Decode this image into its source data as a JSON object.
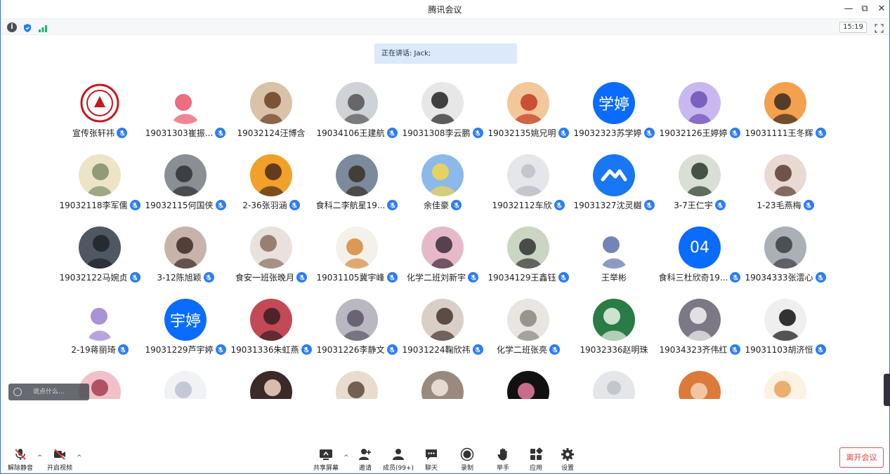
{
  "window": {
    "title": "腾讯会议",
    "minimize": "—",
    "restore": "⧉",
    "close": "✕"
  },
  "infobar": {
    "info_icon": "info-icon",
    "clock": "15:19"
  },
  "speaking": {
    "text": "正在讲话: Jack;"
  },
  "participants": [
    {
      "name": "宣传张轩祎",
      "avatar": "red-seal"
    },
    {
      "name": "19031303崔振...",
      "avatar": "cartoon-figure"
    },
    {
      "name": "19032124汪博含",
      "avatar": "brown-bear",
      "mic": false
    },
    {
      "name": "19034106王建航",
      "avatar": "photo-gray"
    },
    {
      "name": "19031308李云鹏",
      "avatar": "bw-portrait"
    },
    {
      "name": "19032135姚兄明",
      "avatar": "opera-girl"
    },
    {
      "name": "19032323苏学婷",
      "avatar": "text",
      "text": "学婷",
      "color": "#0a6cff"
    },
    {
      "name": "19032126王婷婷",
      "avatar": "anime-purple"
    },
    {
      "name": "19031111王冬辉",
      "avatar": "shiba-dog"
    },
    {
      "name": "19032118李军儒",
      "avatar": "anime-cream"
    },
    {
      "name": "19032115何国侠",
      "avatar": "dark-photo"
    },
    {
      "name": "2-36张羽涵",
      "avatar": "sunset"
    },
    {
      "name": "食科二李航星19...",
      "avatar": "dusk-dog"
    },
    {
      "name": "余佳豪",
      "avatar": "cartoon-boy"
    },
    {
      "name": "19032112车欣",
      "avatar": "default-gray"
    },
    {
      "name": "19031327沈灵樾",
      "avatar": "tencent-logo"
    },
    {
      "name": "3-7王仁宇",
      "avatar": "anime-man"
    },
    {
      "name": "1-23毛燕梅",
      "avatar": "girl-photo"
    },
    {
      "name": "19032122马婉贞",
      "avatar": "man-portrait"
    },
    {
      "name": "3-12陈旭颖",
      "avatar": "girl-dark"
    },
    {
      "name": "食安一班张晚月",
      "avatar": "soft-photo"
    },
    {
      "name": "19031105冀宇峰",
      "avatar": "fox"
    },
    {
      "name": "化学二班刘新宇",
      "avatar": "anime-pink"
    },
    {
      "name": "19034129王鑫钰",
      "avatar": "kid-photo"
    },
    {
      "name": "王举彬",
      "avatar": "chibi",
      "mic": false
    },
    {
      "name": "食科三杜欣奇19...",
      "avatar": "text",
      "text": "04",
      "color": "#0a6cff"
    },
    {
      "name": "19034333张澐心",
      "avatar": "street-photo"
    },
    {
      "name": "2-19蒋丽琦",
      "avatar": "line-cat"
    },
    {
      "name": "19031229芦宇婷",
      "avatar": "text",
      "text": "宇婷",
      "color": "#0a6cff"
    },
    {
      "name": "19031336朱虹燕",
      "avatar": "anime-red"
    },
    {
      "name": "19031226李静文",
      "avatar": "anime-gray"
    },
    {
      "name": "19031224鞠欣祎",
      "avatar": "selfie"
    },
    {
      "name": "化学二班张亮",
      "avatar": "sketch"
    },
    {
      "name": "19032336赵明珠",
      "avatar": "green-girl",
      "mic": false
    },
    {
      "name": "19034323齐伟红",
      "avatar": "white-dress"
    },
    {
      "name": "19031103胡济恒",
      "avatar": "bw-fashion"
    },
    {
      "name": "",
      "avatar": "lotso-bear"
    },
    {
      "name": "",
      "avatar": "light-sketch"
    },
    {
      "name": "",
      "avatar": "baby-girl"
    },
    {
      "name": "",
      "avatar": "bright-photo"
    },
    {
      "name": "",
      "avatar": "girl-hat"
    },
    {
      "name": "",
      "avatar": "black-cat"
    },
    {
      "name": "",
      "avatar": "default-gray"
    },
    {
      "name": "",
      "avatar": "kid-face"
    },
    {
      "name": "",
      "avatar": "cartoon-sticker"
    }
  ],
  "chat": {
    "placeholder": "说点什么..."
  },
  "toolbar": {
    "unmute": "解除静音",
    "video": "开启视频",
    "share": "共享屏幕",
    "invite": "邀请",
    "members": "成员(99+)",
    "chat": "聊天",
    "record": "录制",
    "raise_hand": "举手",
    "apps": "应用",
    "settings": "设置",
    "leave": "离开会议",
    "caret": "^"
  },
  "colors": {
    "accent": "#2a7df5",
    "leave": "#e0403c",
    "speaking_bg": "#dce9fb"
  }
}
